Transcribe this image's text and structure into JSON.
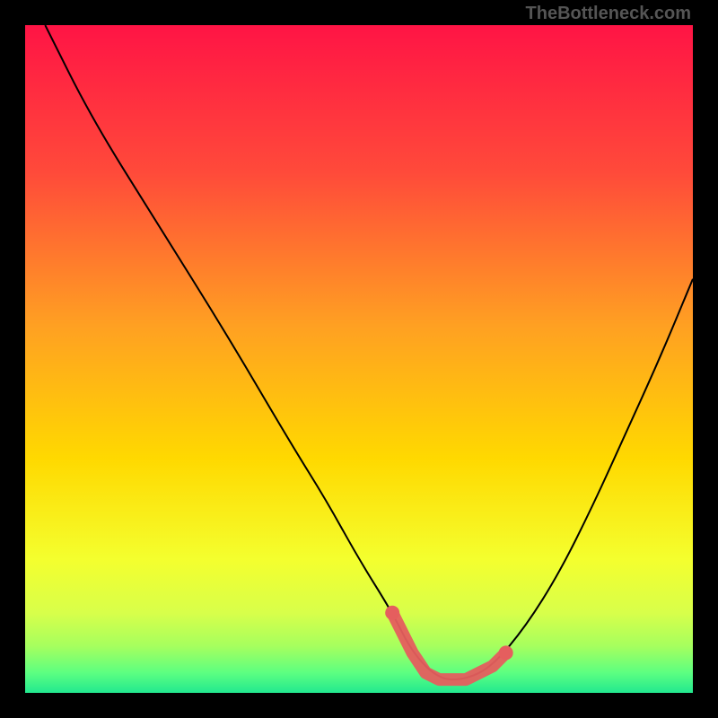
{
  "watermark": "TheBottleneck.com",
  "chart_data": {
    "type": "line",
    "title": "",
    "xlabel": "",
    "ylabel": "",
    "xlim": [
      0,
      100
    ],
    "ylim": [
      0,
      100
    ],
    "grid": false,
    "series": [
      {
        "name": "bottleneck-curve",
        "color": "#000000",
        "x": [
          3,
          10,
          20,
          30,
          40,
          45,
          50,
          55,
          58,
          62,
          66,
          70,
          75,
          80,
          85,
          90,
          95,
          100
        ],
        "y": [
          100,
          86,
          70,
          54,
          37,
          29,
          20,
          12,
          6,
          2,
          2,
          4,
          10,
          18,
          28,
          39,
          50,
          62
        ]
      }
    ],
    "highlight_region": {
      "name": "optimal-range",
      "color": "#e55e5e",
      "x": [
        55,
        58,
        60,
        62,
        64,
        66,
        68,
        70,
        72
      ],
      "y": [
        12,
        6,
        3,
        2,
        2,
        2,
        3,
        4,
        6
      ]
    },
    "background_gradient": {
      "stops": [
        {
          "pos": 0.0,
          "color": "#ff1445"
        },
        {
          "pos": 0.22,
          "color": "#ff4a3a"
        },
        {
          "pos": 0.45,
          "color": "#ffa022"
        },
        {
          "pos": 0.65,
          "color": "#ffd900"
        },
        {
          "pos": 0.8,
          "color": "#f4ff2e"
        },
        {
          "pos": 0.88,
          "color": "#d8ff4a"
        },
        {
          "pos": 0.93,
          "color": "#a6ff5e"
        },
        {
          "pos": 0.97,
          "color": "#5cff81"
        },
        {
          "pos": 1.0,
          "color": "#22e98f"
        }
      ]
    }
  }
}
